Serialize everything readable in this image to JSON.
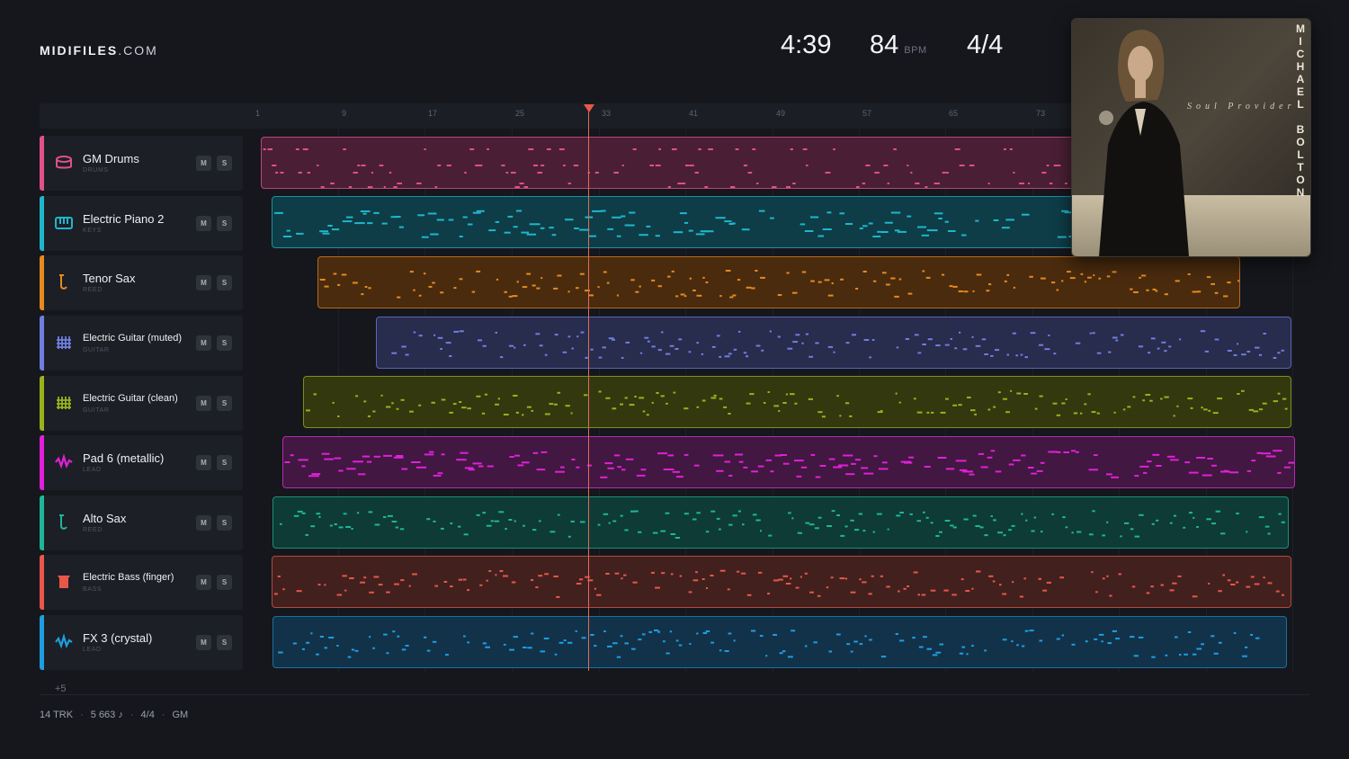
{
  "brand": {
    "name": "MIDIFILES",
    "domain": ".COM"
  },
  "transport": {
    "duration": "4:39",
    "tempo": "84",
    "tempo_unit": "BPM",
    "time_signature": "4/4"
  },
  "ruler": {
    "bars": [
      "1",
      "9",
      "17",
      "25",
      "33",
      "41",
      "49",
      "57",
      "65",
      "73"
    ]
  },
  "playhead": {
    "bar": 31
  },
  "tracks": [
    {
      "name": "GM Drums",
      "category": "DRUMS",
      "color": "#e0508a",
      "icon": "drum-icon",
      "mute": "M",
      "solo": "S"
    },
    {
      "name": "Electric Piano 2",
      "category": "KEYS",
      "color": "#1fb6cc",
      "icon": "piano-icon",
      "mute": "M",
      "solo": "S"
    },
    {
      "name": "Tenor Sax",
      "category": "REED",
      "color": "#e58a1f",
      "icon": "saxophone-icon",
      "mute": "M",
      "solo": "S"
    },
    {
      "name": "Electric Guitar (muted)",
      "category": "GUITAR",
      "color": "#6f7ee0",
      "icon": "guitar-icon",
      "mute": "M",
      "solo": "S"
    },
    {
      "name": "Electric Guitar (clean)",
      "category": "GUITAR",
      "color": "#98b21c",
      "icon": "guitar-icon",
      "mute": "M",
      "solo": "S"
    },
    {
      "name": "Pad 6 (metallic)",
      "category": "LEAD",
      "color": "#e020d8",
      "icon": "wave-icon",
      "mute": "M",
      "solo": "S"
    },
    {
      "name": "Alto Sax",
      "category": "REED",
      "color": "#1fb59a",
      "icon": "saxophone-icon",
      "mute": "M",
      "solo": "S"
    },
    {
      "name": "Electric Bass (finger)",
      "category": "BASS",
      "color": "#e8574a",
      "icon": "bass-icon",
      "mute": "M",
      "solo": "S"
    },
    {
      "name": "FX 3 (crystal)",
      "category": "LEAD",
      "color": "#1e9ee0",
      "icon": "wave-icon",
      "mute": "M",
      "solo": "S"
    }
  ],
  "more_tracks": "+5",
  "footer": {
    "tracks": "14 TRK",
    "notes": "5 663 ♪",
    "time_signature": "4/4",
    "standard": "GM"
  },
  "album": {
    "title": "Soul Provider",
    "artist": "MICHAEL BOLTON"
  }
}
